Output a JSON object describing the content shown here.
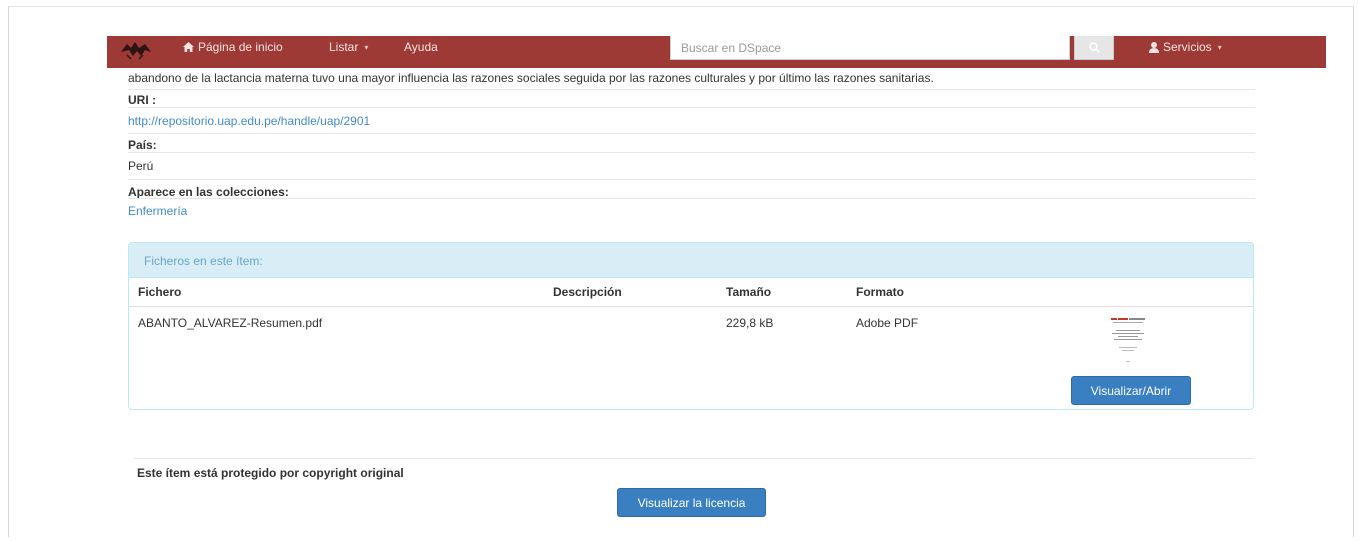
{
  "navbar": {
    "home_label": "Página de inicio",
    "browse_label": "Listar",
    "help_label": "Ayuda",
    "search_placeholder": "Buscar en DSpace",
    "services_label": "Servicios",
    "bg_color": "#9e3a36"
  },
  "item": {
    "abstract_tail": "abandono de la lactancia materna tuvo una mayor influencia las razones sociales seguida por las razones culturales y por último las razones sanitarias.",
    "uri_label": "URI :",
    "uri_value": "http://repositorio.uap.edu.pe/handle/uap/2901",
    "country_label": "País:",
    "country_value": "Perú",
    "collections_label": "Aparece en las colecciones:",
    "collection_value": "Enfermería"
  },
  "files_panel": {
    "heading": "Ficheros en este ítem:",
    "columns": [
      "Fichero",
      "Descripción",
      "Tamaño",
      "Formato"
    ],
    "rows": [
      {
        "file": "ABANTO_ALVAREZ-Resumen.pdf",
        "description": "",
        "size": "229,8 kB",
        "format": "Adobe PDF",
        "action": "Visualizar/Abrir"
      }
    ]
  },
  "footer": {
    "copyright_text": "Este ítem está protegido por copyright original",
    "license_button": "Visualizar la licencia"
  },
  "icons": {
    "home": "home-icon",
    "search": "search-icon",
    "user": "user-icon",
    "logo": "logo-icon"
  }
}
